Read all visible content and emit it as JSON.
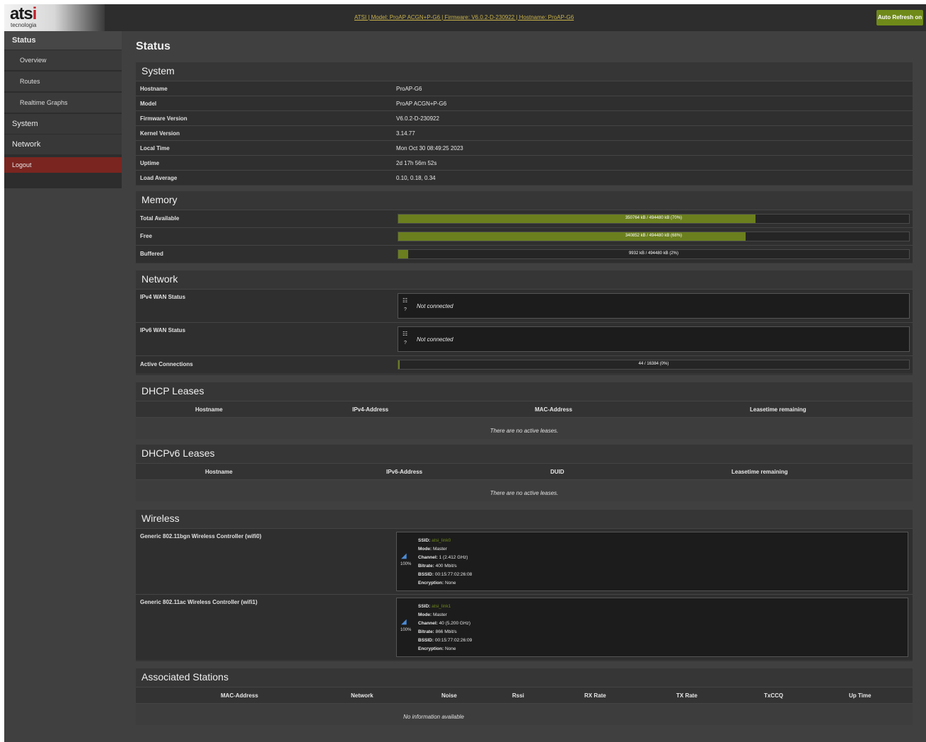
{
  "brand": {
    "name": "atsi",
    "sub": "tecnologia"
  },
  "topbar": {
    "info": "ATSI | Model: ProAP ACGN+P-G6 | Firmware: V6.0.2-D-230922 | Hostname: ProAP-G6",
    "auto_refresh": "Auto Refresh on"
  },
  "sidebar": {
    "status": "Status",
    "overview": "Overview",
    "routes": "Routes",
    "realtime": "Realtime Graphs",
    "system": "System",
    "network": "Network",
    "logout": "Logout"
  },
  "page_title": "Status",
  "system": {
    "title": "System",
    "rows": [
      {
        "label": "Hostname",
        "value": "ProAP-G6"
      },
      {
        "label": "Model",
        "value": "ProAP ACGN+P-G6"
      },
      {
        "label": "Firmware Version",
        "value": "V6.0.2-D-230922"
      },
      {
        "label": "Kernel Version",
        "value": "3.14.77"
      },
      {
        "label": "Local Time",
        "value": "Mon Oct 30 08:49:25 2023"
      },
      {
        "label": "Uptime",
        "value": "2d 17h 56m 52s"
      },
      {
        "label": "Load Average",
        "value": "0.10, 0.18, 0.34"
      }
    ]
  },
  "memory": {
    "title": "Memory",
    "rows": [
      {
        "label": "Total Available",
        "text": "350764 kB / 494480 kB (70%)",
        "fraction": 0.7
      },
      {
        "label": "Free",
        "text": "340852 kB / 494480 kB (68%)",
        "fraction": 0.68
      },
      {
        "label": "Buffered",
        "text": "9932 kB / 494480 kB (2%)",
        "fraction": 0.02
      }
    ]
  },
  "network": {
    "title": "Network",
    "ipv4_label": "IPv4 WAN Status",
    "ipv6_label": "IPv6 WAN Status",
    "not_connected": "Not connected",
    "q": "?",
    "active_label": "Active Connections",
    "active_text": "44 / 16384 (0%)",
    "active_fraction": 0.003
  },
  "dhcp": {
    "title": "DHCP Leases",
    "headers": [
      "Hostname",
      "IPv4-Address",
      "MAC-Address",
      "Leasetime remaining"
    ],
    "empty": "There are no active leases."
  },
  "dhcp6": {
    "title": "DHCPv6 Leases",
    "headers": [
      "Hostname",
      "IPv6-Address",
      "DUID",
      "Leasetime remaining"
    ],
    "empty": "There are no active leases."
  },
  "wireless": {
    "title": "Wireless",
    "devices": [
      {
        "label": "Generic 802.11bgn Wireless Controller (wifi0)",
        "pct": "100%",
        "ssid": "atsi_link0",
        "mode": "Master",
        "channel": "1 (2.412 GHz)",
        "bitrate": "400 Mbit/s",
        "bssid": "00:15:77:02:26:08",
        "encryption": "None"
      },
      {
        "label": "Generic 802.11ac Wireless Controller (wifi1)",
        "pct": "100%",
        "ssid": "atsi_link1",
        "mode": "Master",
        "channel": "40 (5.200 GHz)",
        "bitrate": "866 Mbit/s",
        "bssid": "00:15:77:02:26:09",
        "encryption": "None"
      }
    ],
    "keys": {
      "ssid": "SSID:",
      "mode": "Mode:",
      "channel": "Channel:",
      "bitrate": "Bitrate:",
      "bssid": "BSSID:",
      "encryption": "Encryption:"
    }
  },
  "stations": {
    "title": "Associated Stations",
    "headers": [
      "MAC-Address",
      "Network",
      "Noise",
      "Rssi",
      "RX Rate",
      "TX Rate",
      "TxCCQ",
      "Up Time"
    ],
    "empty": "No information available"
  },
  "colors": {
    "accent": "#6f8a19",
    "logout": "#7a2520",
    "link": "#c9b24a"
  }
}
